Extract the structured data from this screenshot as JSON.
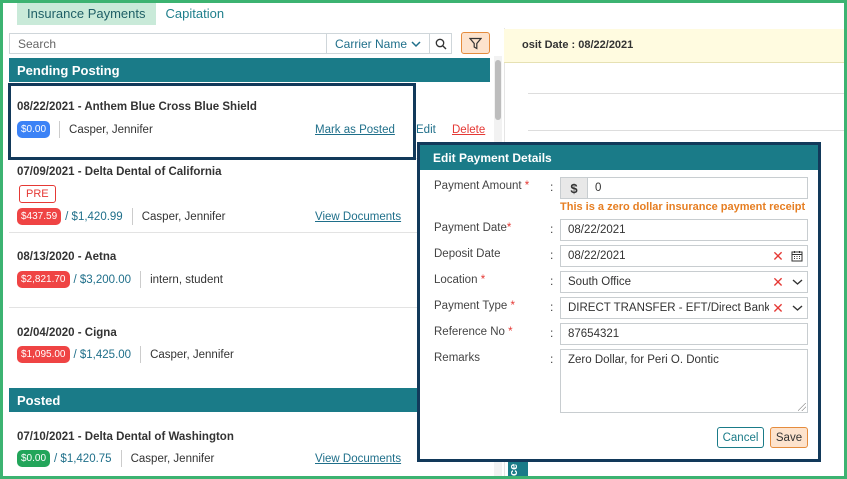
{
  "tabs": [
    {
      "label": "Insurance Payments",
      "active": true
    },
    {
      "label": "Capitation",
      "active": false
    }
  ],
  "search": {
    "placeholder": "Search",
    "carrier_label": "Carrier Name"
  },
  "sections": {
    "pending": "Pending Posting",
    "posted": "Posted"
  },
  "pending_items": [
    {
      "title": "08/22/2021 - Anthem Blue Cross Blue Shield",
      "amount": "$0.00",
      "total": "",
      "person": "Casper, Jennifer",
      "action": "Mark as Posted",
      "edit": "Edit",
      "delete": "Delete"
    },
    {
      "title": "07/09/2021 - Delta Dental of California",
      "badge": "PRE",
      "amount": "$437.59",
      "total": "/ $1,420.99",
      "person": "Casper, Jennifer",
      "action": "View Documents"
    },
    {
      "title": "08/13/2020 - Aetna",
      "amount": "$2,821.70",
      "total": "/ $3,200.00",
      "person": "intern, student"
    },
    {
      "title": "02/04/2020 - Cigna",
      "amount": "$1,095.00",
      "total": "/ $1,425.00",
      "person": "Casper, Jennifer"
    }
  ],
  "posted_items": [
    {
      "title": "07/10/2021 - Delta Dental of Washington",
      "amount": "$0.00",
      "total": "/ $1,420.75",
      "person": "Casper, Jennifer",
      "action": "View Documents"
    }
  ],
  "deposit_header": "osit Date : 08/22/2021",
  "vertical_tab": "ce",
  "dialog": {
    "title": "Edit Payment Details",
    "fields": {
      "payment_amount": {
        "label": "Payment Amount",
        "currency": "$",
        "value": "0"
      },
      "warning": "This is a zero dollar insurance payment receipt",
      "payment_date": {
        "label": "Payment Date",
        "value": "08/22/2021"
      },
      "deposit_date": {
        "label": "Deposit Date",
        "value": "08/22/2021"
      },
      "location": {
        "label": "Location",
        "value": "South Office"
      },
      "payment_type": {
        "label": "Payment Type",
        "value": "DIRECT TRANSFER - EFT/Direct Bank Transfer"
      },
      "reference_no": {
        "label": "Reference No",
        "value": "87654321"
      },
      "remarks": {
        "label": "Remarks",
        "value": "Zero Dollar, for Peri O. Dontic"
      }
    },
    "required_mark": "*",
    "colon": ":",
    "cancel_label": "Cancel",
    "save_label": "Save"
  },
  "colors": {
    "teal": "#1a7b88",
    "accent_orange": "#e58c3d",
    "highlight_border": "#12395a",
    "frame_green": "#3cb371"
  }
}
